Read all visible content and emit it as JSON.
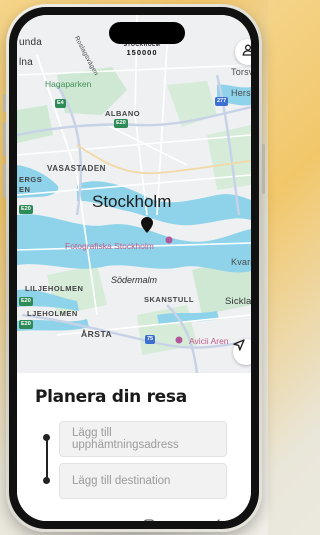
{
  "map": {
    "city": "Stockholm",
    "labels": {
      "sundbyberg_partial": "unda",
      "solna_partial": "lna",
      "hagaparken": "Hagaparken",
      "albano": "ALBANO",
      "vasastaden": "VASASTADEN",
      "kungsholmen_partial": "ERGS",
      "kungsholmen_partial2": "EN",
      "fotografiska": "Fotografiska Stockholm",
      "sodermalm": "Södermalm",
      "liljeholmen1": "LILJEHOLMEN",
      "liljeholmen2": "LJEHOLMEN",
      "skanstull": "SKANSTULL",
      "arsta": "ÅRSTA",
      "avicii": "Avicii Aren",
      "torsvik": "Torsvi",
      "hersby": "Herser",
      "kvarnholmen": "Kvarn",
      "sickla": "Sickla",
      "roslagsvagen": "Roslagsvägen"
    },
    "badges": {
      "e4": "E4",
      "e20a": "E20",
      "e20b": "E20",
      "e20c": "E20",
      "e20d": "E20",
      "r277": "277",
      "r75": "75"
    }
  },
  "header": {
    "brand_line1": "STOCKHOLM",
    "brand_line2": "150000"
  },
  "sheet": {
    "title": "Planera din resa",
    "pickup_placeholder": "Lägg till upphämtningsadress",
    "destination_placeholder": "Lägg till destination"
  },
  "colors": {
    "water": "#8fd3ea",
    "land": "#eef0f2",
    "park": "#cfe8d3",
    "road": "#ffffff",
    "major_road": "#c8d2e6"
  }
}
